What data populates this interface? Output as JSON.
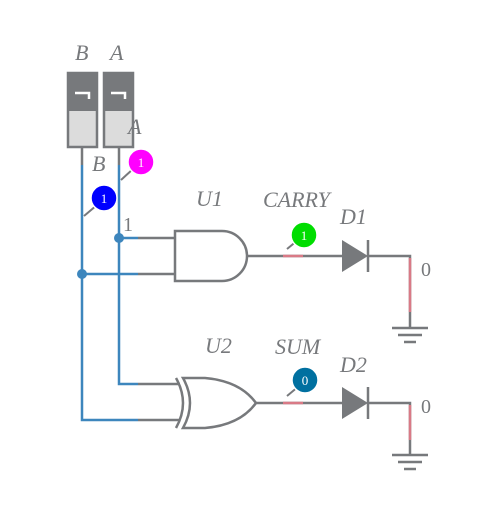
{
  "switches": [
    {
      "label": "B",
      "net_label": "B"
    },
    {
      "label": "A",
      "net_label": "A"
    }
  ],
  "node_label": "1",
  "gates": [
    {
      "ref": "U1",
      "type": "AND"
    },
    {
      "ref": "U2",
      "type": "XOR"
    }
  ],
  "outputs": [
    {
      "net": "CARRY",
      "diode": "D1",
      "ground_label": "0",
      "probe_value": "1",
      "probe_color": "#00dd00"
    },
    {
      "net": "SUM",
      "diode": "D2",
      "ground_label": "0",
      "probe_value": "0",
      "probe_color": "#0070a0"
    }
  ],
  "probes": [
    {
      "value": "1",
      "color": "#ff00ff"
    },
    {
      "value": "1",
      "color": "#0000ff"
    }
  ],
  "colors": {
    "wire": "#77797c",
    "active_wire": "#3d86bd",
    "ground_wire": "#d97a86"
  }
}
